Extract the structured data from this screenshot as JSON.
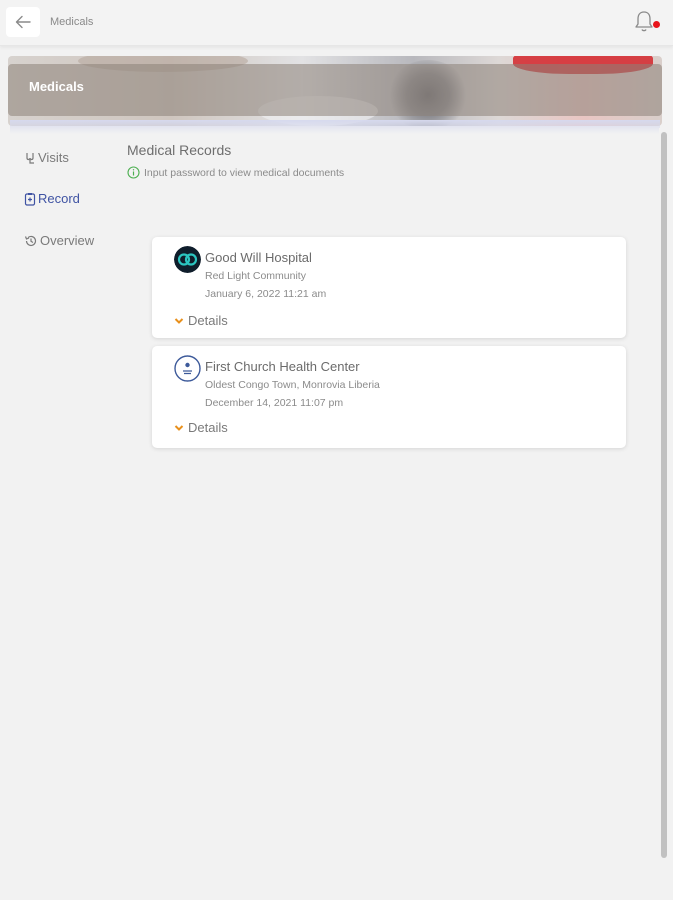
{
  "topbar": {
    "title": "Medicals",
    "back_icon": "arrow-left-icon",
    "bell_icon": "bell-icon",
    "notification_dot_color": "#e8141b"
  },
  "banner": {
    "title": "Medicals"
  },
  "sidebar": {
    "items": [
      {
        "label": "Visits",
        "icon": "visits-icon",
        "active": false
      },
      {
        "label": "Record",
        "icon": "record-icon",
        "active": true
      },
      {
        "label": "Overview",
        "icon": "history-icon",
        "active": false
      }
    ]
  },
  "main": {
    "title": "Medical Records",
    "hint": "Input password to view medical documents",
    "hint_icon": "info-circle-icon",
    "records": [
      {
        "name": "Good Will Hospital",
        "address": "Red Light Community",
        "date": "January 6, 2022 11:21 am",
        "details_label": "Details"
      },
      {
        "name": "First Church Health Center",
        "address": "Oldest Congo Town, Monrovia Liberia",
        "date": "December 14, 2021 11:07 pm",
        "details_label": "Details"
      }
    ]
  },
  "colors": {
    "accent": "#3f53a3",
    "chevron": "#e8901c",
    "hint_icon": "#4caf50"
  }
}
